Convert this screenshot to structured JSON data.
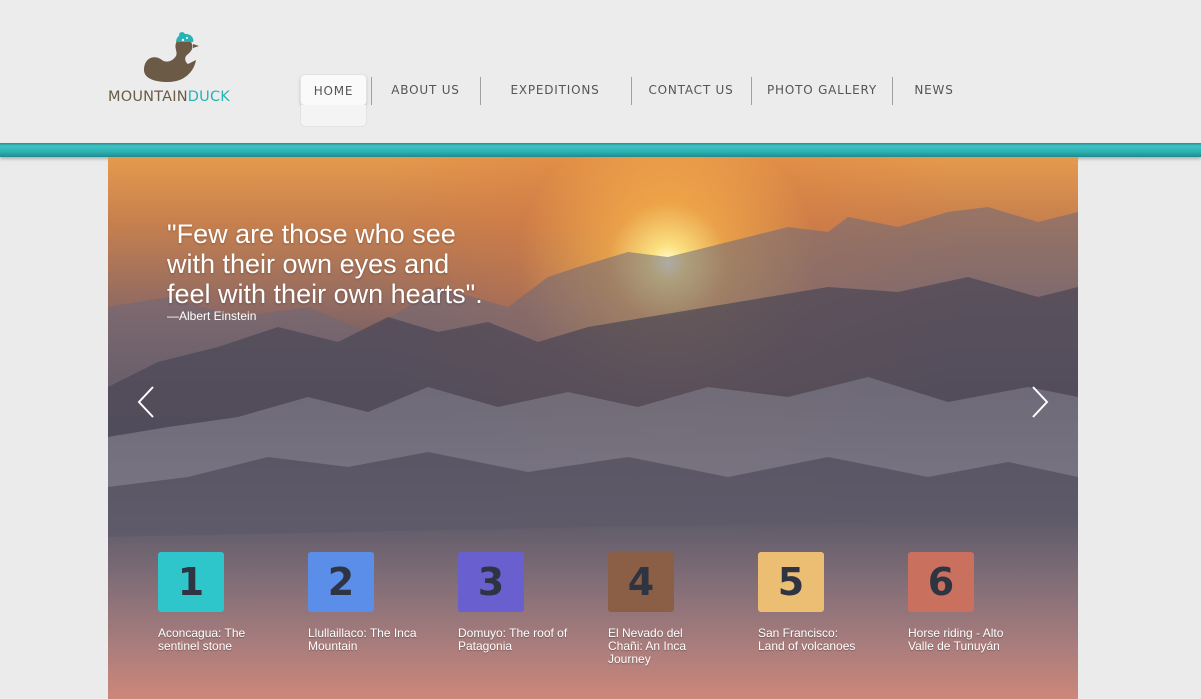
{
  "logo": {
    "part1": "MOUNTAIN",
    "part2": "DUCK"
  },
  "nav": {
    "items": [
      {
        "label": "HOME"
      },
      {
        "label": "ABOUT US"
      },
      {
        "label": "EXPEDITIONS"
      },
      {
        "label": "CONTACT US"
      },
      {
        "label": "PHOTO GALLERY"
      },
      {
        "label": "NEWS"
      }
    ]
  },
  "hero": {
    "quote_line1": "\"Few are those who see",
    "quote_line2": "with their own eyes and",
    "quote_line3": "feel with their own hearts\".",
    "author": "—Albert Einstein",
    "tiles": [
      {
        "number": "1",
        "caption": "Aconcagua: The sentinel stone",
        "color": "#2ec5cb"
      },
      {
        "number": "2",
        "caption": "Llullaillaco: The Inca Mountain",
        "color": "#5b8ee8"
      },
      {
        "number": "3",
        "caption": "Domuyo: The roof of Patagonia",
        "color": "#6a5fcf"
      },
      {
        "number": "4",
        "caption": "El Nevado del Chañi: An Inca Journey",
        "color": "#8b5e46"
      },
      {
        "number": "5",
        "caption": "San Francisco: Land of volcanoes",
        "color": "#ecbe74"
      },
      {
        "number": "6",
        "caption": "Horse riding - Alto Valle de Tunuyán",
        "color": "#c9705e"
      }
    ]
  },
  "colors": {
    "accent": "#2bb0b3",
    "logo_brown": "#6b5a45"
  }
}
